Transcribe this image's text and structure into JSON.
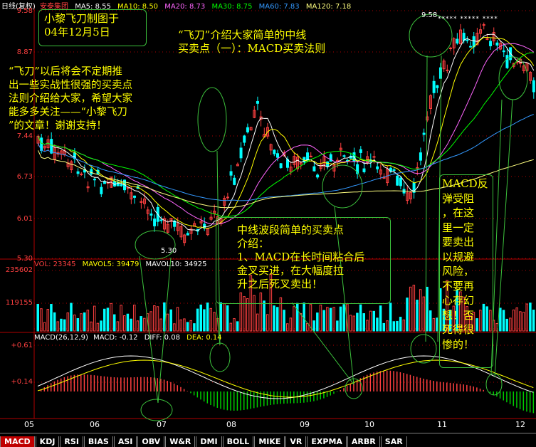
{
  "colors": {
    "accent": "#c00000",
    "up": "#ff4040",
    "down": "#00ffff",
    "grid": "#b00000",
    "ma5": "#ffffff",
    "ma10": "#ffff00",
    "ma20": "#ff66ff",
    "ma30": "#00ff00",
    "ma60": "#3399ff",
    "ma120": "#ffff80",
    "annotation": "#ffff00",
    "annotation_box": "#3cc23c"
  },
  "header": {
    "chart_name": "日线(复权)",
    "stock_name": "安泰集团",
    "ma5": "MA5: 8.55",
    "ma10": "MA10: 8.50",
    "ma20": "MA20: 8.73",
    "ma30": "MA30: 8.75",
    "ma60": "MA60: 7.83",
    "ma120": "MA120: 7.18"
  },
  "price_axis": [
    "9.58",
    "8.87",
    "7.44",
    "6.73",
    "6.01",
    "5.30"
  ],
  "price_marks": {
    "high": "9.58",
    "low": "5.30"
  },
  "star_row": "***** ***** ****",
  "volume": {
    "vol": "VOL: 23345",
    "mavol5": "MAVOL5: 39479",
    "mavol10": "MAVOL10: 34925",
    "axis": [
      "235602",
      "119155"
    ]
  },
  "macd": {
    "label": "MACD(26,12,9)",
    "macd_value": "MACD: -0.12",
    "diff_value": "DIFF: 0.08",
    "dea_value": "DEA: 0.14",
    "axis": [
      "+0.61",
      "+0.14"
    ]
  },
  "x_axis": [
    "05",
    "06",
    "07",
    "08",
    "09",
    "10",
    "11",
    "12"
  ],
  "tabs": [
    "MACD",
    "KDJ",
    "RSI",
    "BIAS",
    "ASI",
    "OBV",
    "W&R",
    "DMI",
    "BOLL",
    "MIKE",
    "VR",
    "EXPMA",
    "ARBR",
    "SAR"
  ],
  "annotations": {
    "author": "小黎飞刀制图于\n04年12月5日",
    "title": "“飞刀”介绍大家简单的中线\n买卖点（一）：MACD买卖法则",
    "intro": "“飞刀”以后将会不定期推\n出一些实战性很强的买卖点\n法则介绍给大家，希望大家\n能多多关注——“小黎飞刀\n”的文章！谢谢支持！",
    "method": "中线波段简单的买卖点\n介绍：\n1、MACD在长时间粘合后\n金叉买进，在大幅度拉\n升之后死叉卖出！",
    "warning": "MACD反\n弹受阻\n，在这\n里一定\n要卖出\n以规避\n风险，\n不要再\n心存幻\n想！否\n死得很\n惨的！"
  }
}
